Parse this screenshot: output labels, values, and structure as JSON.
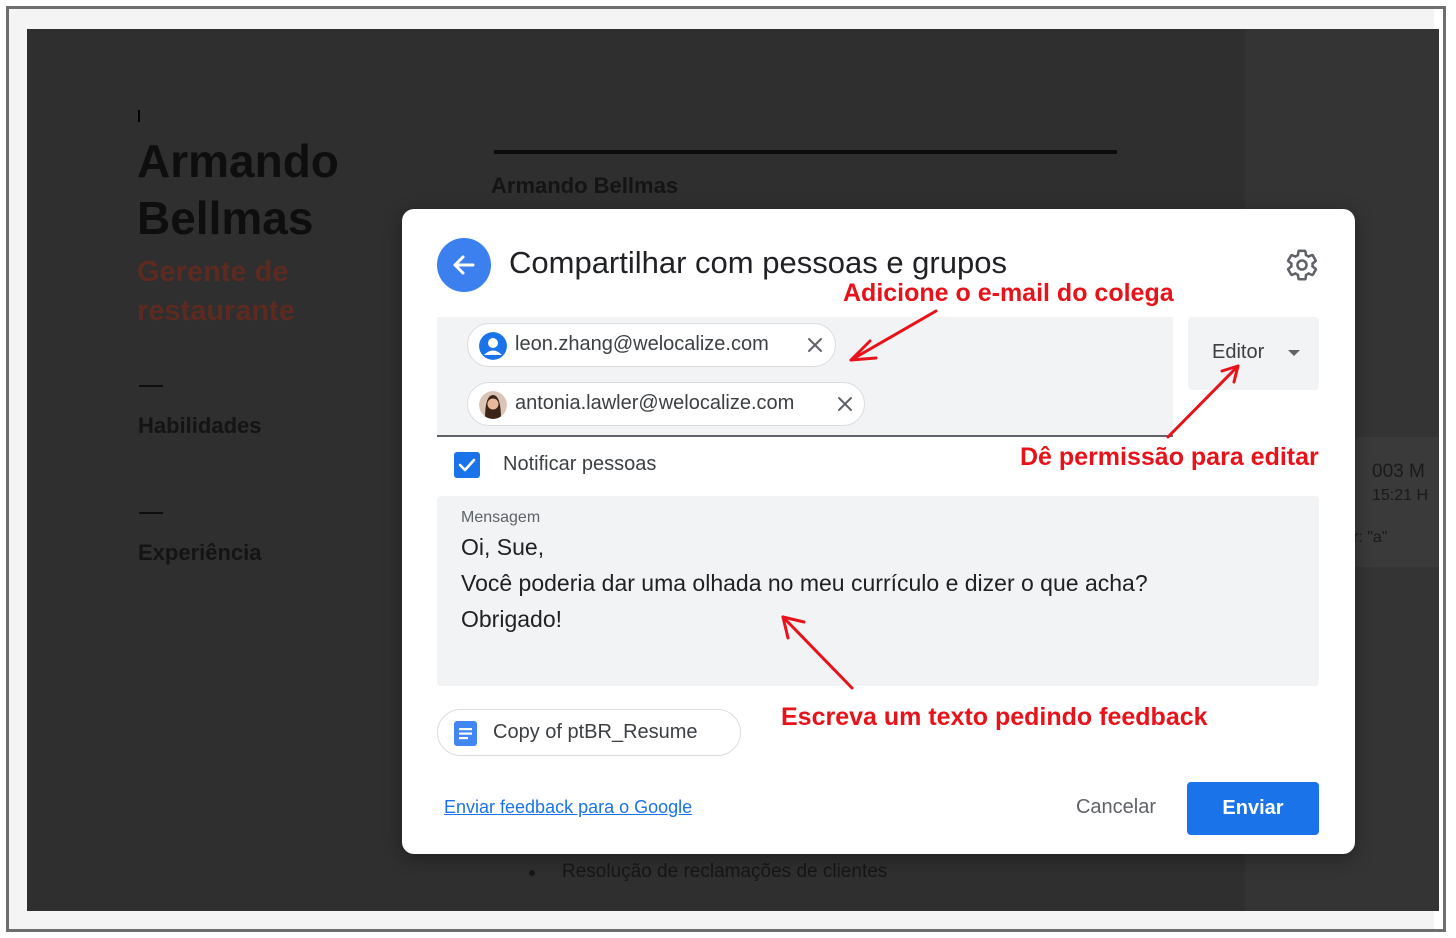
{
  "document": {
    "name": "Armando Bellmas",
    "role": "Gerente de restaurante",
    "sections": [
      "Habilidades",
      "Experiência"
    ],
    "header_name": "Armando Bellmas",
    "bullet_text": "Resolução de reclamações de clientes",
    "side_text_1": "003 M",
    "side_text_2": "15:21 H",
    "side_text_3": "r: \"a\""
  },
  "dialog": {
    "title": "Compartilhar com pessoas e grupos",
    "recipients": [
      {
        "email": "leon.zhang@welocalize.com"
      },
      {
        "email": "antonia.lawler@welocalize.com"
      }
    ],
    "role_label": "Editor",
    "notify_label": "Notificar pessoas",
    "notify_checked": true,
    "message_caption": "Mensagem",
    "message_lines": [
      "Oi, Sue,",
      "Você poderia dar uma olhada no meu currículo e dizer o que acha?",
      "Obrigado!"
    ],
    "file_name": "Copy of ptBR_Resume",
    "feedback_link": "Enviar feedback para o Google",
    "cancel_label": "Cancelar",
    "send_label": "Enviar"
  },
  "annotations": {
    "add_email": "Adicione o e-mail do colega",
    "give_permission": "Dê permissão para editar",
    "write_text": "Escreva um texto pedindo feedback"
  },
  "colors": {
    "accent": "#1a73e8",
    "annotation": "#e8121a",
    "overlay": "#2f2f2f"
  }
}
